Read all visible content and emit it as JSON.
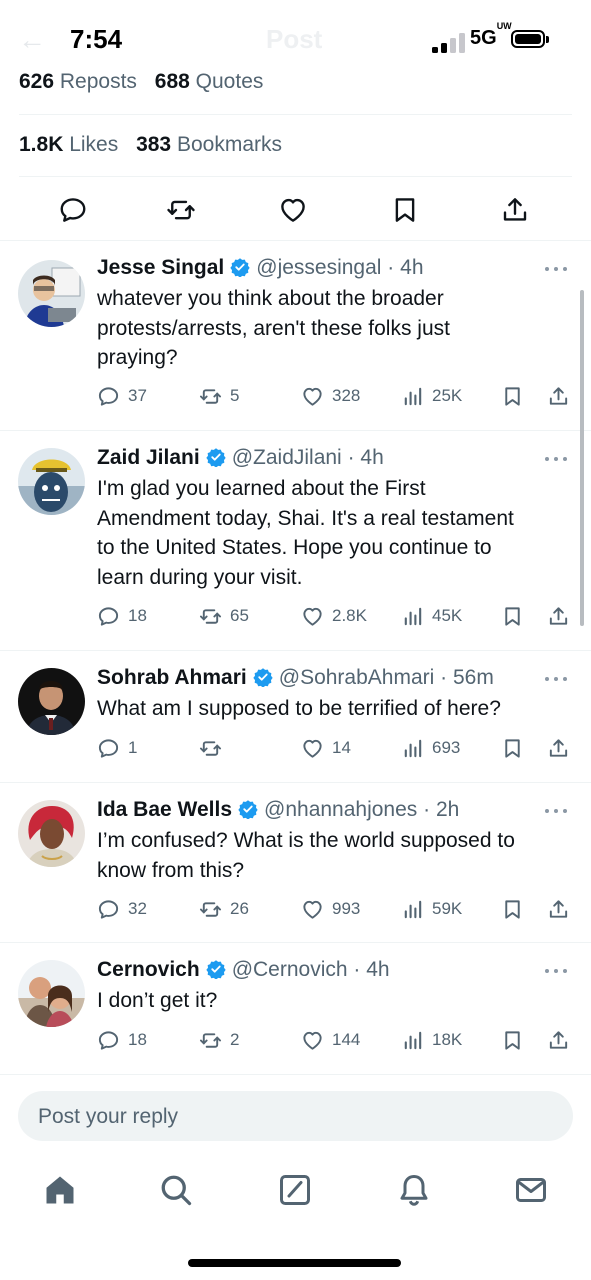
{
  "status_bar": {
    "time": "7:54",
    "network": "5G",
    "network_sup": "UW",
    "battery_level": 1.0
  },
  "header_ghost": {
    "back": "←",
    "title": "Post"
  },
  "post_stats": {
    "reposts": {
      "count": "626",
      "label": "Reposts"
    },
    "quotes": {
      "count": "688",
      "label": "Quotes"
    },
    "likes": {
      "count": "1.8K",
      "label": "Likes"
    },
    "bookmarks": {
      "count": "383",
      "label": "Bookmarks"
    }
  },
  "post_actions": [
    "reply-icon",
    "repost-icon",
    "like-icon",
    "bookmark-icon",
    "share-icon"
  ],
  "colors": {
    "text_primary": "#0f1419",
    "text_secondary": "#536471",
    "verified_blue": "#1d9bf0",
    "divider": "#eff3f4"
  },
  "replies": [
    {
      "name": "Jesse Singal",
      "handle": "@jessesingal",
      "time": "4h",
      "lines": [
        "whatever you think about the broader",
        "protests/arrests, aren't these folks just",
        "praying?"
      ],
      "replies": "37",
      "reposts": "5",
      "likes": "328",
      "views": "25K"
    },
    {
      "name": "Zaid Jilani",
      "handle": "@ZaidJilani",
      "time": "4h",
      "lines": [
        "I'm glad you learned about the First",
        "Amendment today, Shai. It's a real testament",
        "to the United States. Hope you continue to",
        "learn during your visit."
      ],
      "replies": "18",
      "reposts": "65",
      "likes": "2.8K",
      "views": "45K"
    },
    {
      "name": "Sohrab Ahmari",
      "handle": "@SohrabAhmari",
      "time": "56m",
      "lines": [
        "What am I supposed to be terrified of here?"
      ],
      "replies": "1",
      "reposts": "",
      "likes": "14",
      "views": "693"
    },
    {
      "name": "Ida Bae Wells",
      "handle": "@nhannahjones",
      "time": "2h",
      "lines": [
        "I’m confused? What is the world supposed to",
        "know from this?"
      ],
      "replies": "32",
      "reposts": "26",
      "likes": "993",
      "views": "59K"
    },
    {
      "name": "Cernovich",
      "handle": "@Cernovich",
      "time": "4h",
      "lines": [
        "I don’t get it?"
      ],
      "replies": "18",
      "reposts": "2",
      "likes": "144",
      "views": "18K"
    }
  ],
  "composer": {
    "placeholder": "Post your reply"
  },
  "tabbar": [
    "home-icon",
    "search-icon",
    "compose-icon",
    "notifications-icon",
    "messages-icon"
  ]
}
